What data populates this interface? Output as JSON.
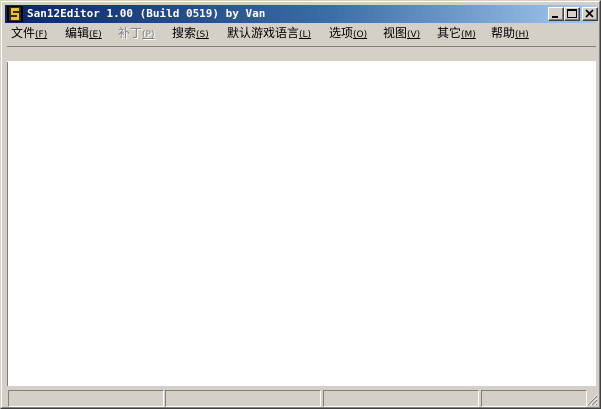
{
  "window": {
    "title": "San12Editor 1.00 (Build 0519) by Van",
    "app_icon": "app-icon",
    "controls": [
      "minimize-icon",
      "maximize-icon",
      "close-icon"
    ]
  },
  "menu": {
    "items": [
      {
        "label": "文件",
        "accel": "(F)",
        "enabled": true
      },
      {
        "label": "编辑",
        "accel": "(E)",
        "enabled": true
      },
      {
        "label": "补丁",
        "accel": "(P)",
        "enabled": false
      },
      {
        "label": "搜索",
        "accel": "(S)",
        "enabled": true
      },
      {
        "label": "默认游戏语言",
        "accel": "(L)",
        "enabled": true
      },
      {
        "label": "选项",
        "accel": "(O)",
        "enabled": true
      },
      {
        "label": "视图",
        "accel": "(V)",
        "enabled": true
      },
      {
        "label": "其它",
        "accel": "(M)",
        "enabled": true
      },
      {
        "label": "帮助",
        "accel": "(H)",
        "enabled": true
      }
    ]
  },
  "statusbar": {
    "panels": [
      "",
      "",
      "",
      ""
    ]
  },
  "colors": {
    "titlebar_start": "#0a246a",
    "titlebar_end": "#a6caf0",
    "face": "#d4d0c8",
    "client": "#ffffff"
  }
}
